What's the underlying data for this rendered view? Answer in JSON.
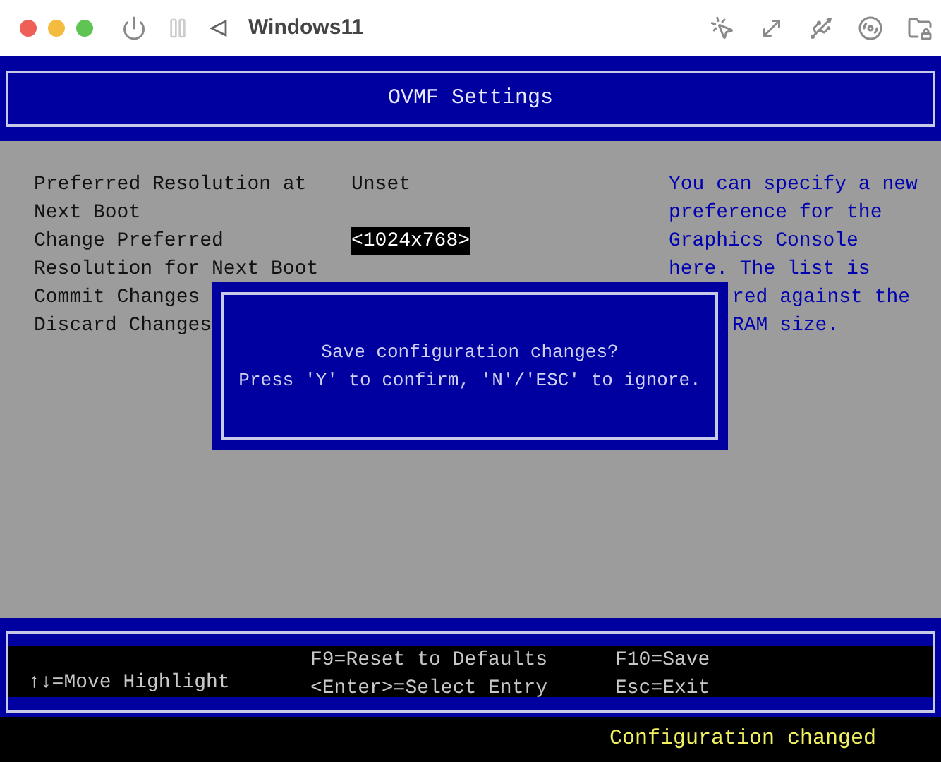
{
  "window": {
    "title": "Windows11"
  },
  "header": {
    "title": "OVMF Settings"
  },
  "settings": [
    {
      "label_lines": [
        "Preferred Resolution at",
        "Next Boot"
      ],
      "value": "Unset",
      "selected": false
    },
    {
      "label_lines": [
        "Change Preferred",
        "Resolution for Next Boot"
      ],
      "value": "<1024x768>",
      "selected": true
    },
    {
      "label_lines": [
        "Commit Changes"
      ]
    },
    {
      "label_lines": [
        "Discard Changes"
      ]
    }
  ],
  "help": [
    {
      "text": "You can specify a new",
      "covered": false
    },
    {
      "text": "preference for the",
      "covered": false
    },
    {
      "text": "Graphics Console",
      "covered": false
    },
    {
      "text": "here. The list is",
      "covered": false
    },
    {
      "text": "red against the",
      "covered": true
    },
    {
      "text": "RAM size.",
      "covered": true
    }
  ],
  "dialog": {
    "lines": [
      "Save configuration changes?",
      "Press 'Y' to confirm, 'N'/'ESC' to ignore."
    ]
  },
  "footer": {
    "columns": [
      [
        "",
        "↑↓=Move Highlight"
      ],
      [
        "F9=Reset to Defaults",
        "<Enter>=Select Entry"
      ],
      [
        "F10=Save",
        "Esc=Exit"
      ]
    ]
  },
  "status": "Configuration changed"
}
